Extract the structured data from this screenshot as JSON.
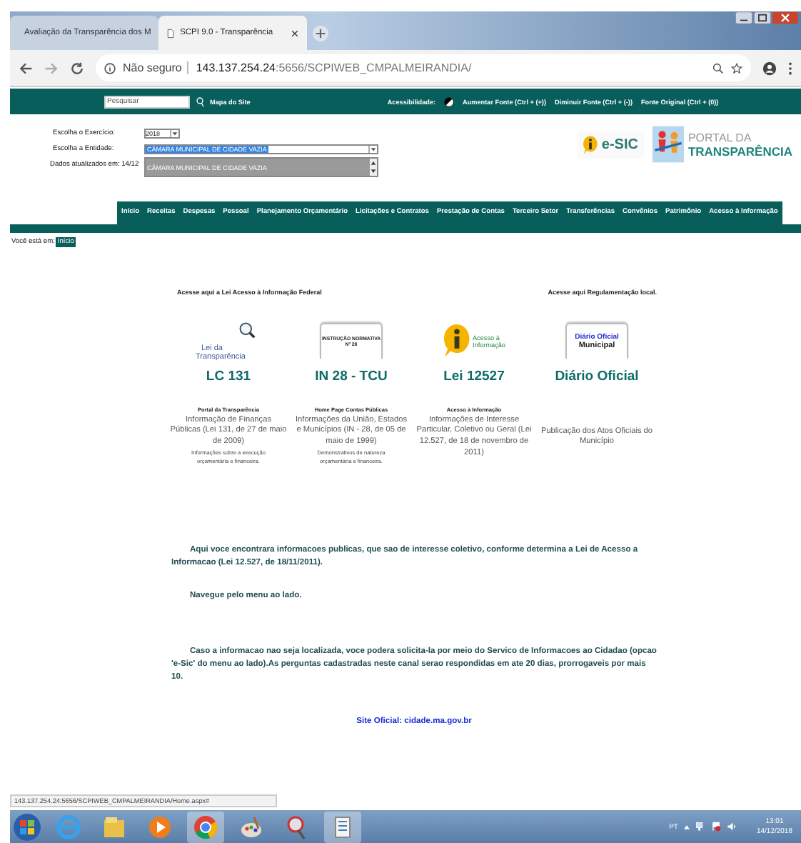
{
  "browser": {
    "tabs": [
      {
        "title": "Avaliação da Transparência dos M",
        "selected": false
      },
      {
        "title": "SCPI 9.0 - Transparência",
        "selected": true
      }
    ],
    "address": {
      "security": "Não seguro",
      "host": "143.137.254.24",
      "path": ":5656/SCPIWEB_CMPALMEIRANDIA/"
    }
  },
  "topbar": {
    "search_placeholder": "Pesquisar",
    "sitemap": "Mapa do Site",
    "accessibility": "Acessibilidade:",
    "links": [
      "Aumentar Fonte (Ctrl + (+))",
      "Diminuir Fonte (Ctrl + (-))",
      "Fonte Original (Ctrl + (0))"
    ]
  },
  "selection": {
    "exercise_label": "Escolha o Exercício:",
    "exercise_value": "2018",
    "entity_label": "Escolha a Entidade:",
    "entity_value": "CÂMARA MUNICIPAL DE CIDADE VAZIA",
    "updated_label": "Dados atualizados em: 14/12",
    "options": [
      "CÂMARA MUNICIPAL DE CIDADE VAZIA"
    ]
  },
  "logos": {
    "esic": "e-SIC",
    "portal_top": "PORTAL DA",
    "portal_bottom": "TRANSPARÊNCIA"
  },
  "menu": [
    "Início",
    "Receitas",
    "Despesas",
    "Pessoal",
    "Planejamento Orçamentário",
    "Licitações e Contratos",
    "Prestação de Contas",
    "Terceiro Setor",
    "Transferências",
    "Convênios",
    "Patrimônio",
    "Acesso à Informação"
  ],
  "breadcrumb": {
    "label": "Você está em:",
    "current": "Início"
  },
  "headings": {
    "federal": "Acesse aqui a Lei Acesso à Informação Federal",
    "local": "Acesse aqui Regulamentação local."
  },
  "cards": [
    {
      "kind": "lupa",
      "logo": [
        "Lei da",
        "Transparência"
      ],
      "title": "LC 131",
      "subtitle": "Portal da Transparência",
      "description": "Informação de Finanças Públicas (Lei 131, de 27 de maio de 2009)",
      "note": "Informações sobre a execução orçamentária e financeira."
    },
    {
      "kind": "document",
      "logo": [
        "INSTRUÇÃO NORMATIVA",
        "Nº 28"
      ],
      "title": "IN 28 - TCU",
      "subtitle": "Home Page Contas Públicas",
      "description": "Informações da União, Estados e Municípios (IN - 28, de 05 de maio de 1999)",
      "note": "Demonstrativos de natureza orçamentária e financeira."
    },
    {
      "kind": "info",
      "logo": [
        "Acesso à",
        "Informação"
      ],
      "title": "Lei 12527",
      "subtitle": "Acesso à Informação",
      "description": "Informações de Interesse Particular, Coletivo ou Geral (Lei 12.527, de 18 de novembro de 2011)"
    },
    {
      "kind": "document",
      "logo": [
        "Diário Oficial",
        "Municipal"
      ],
      "title": "Diário Oficial",
      "description": "Publicação dos Atos Oficiais do Município"
    }
  ],
  "paragraphs": [
    "Aqui voce encontrara informacoes publicas, que sao de interesse coletivo, conforme determina a Lei de Acesso a Informacao (Lei 12.527, de 18/11/2011).",
    "Navegue pelo menu ao lado.",
    "Caso a informacao nao seja localizada, voce podera solicita-la por meio do Servico de Informacoes ao Cidadao (opcao 'e-Sic' do menu ao lado).As perguntas cadastradas neste canal serao respondidas em ate 20 dias, prorrogaveis por mais 10."
  ],
  "site_link": "Site Oficial: cidade.ma.gov.br",
  "status_url": "143.137.254.24:5656/SCPIWEB_CMPALMEIRANDIA/Home.aspx#",
  "taskbar": {
    "language": "PT",
    "time": "13:01",
    "date": "14/12/2018"
  }
}
